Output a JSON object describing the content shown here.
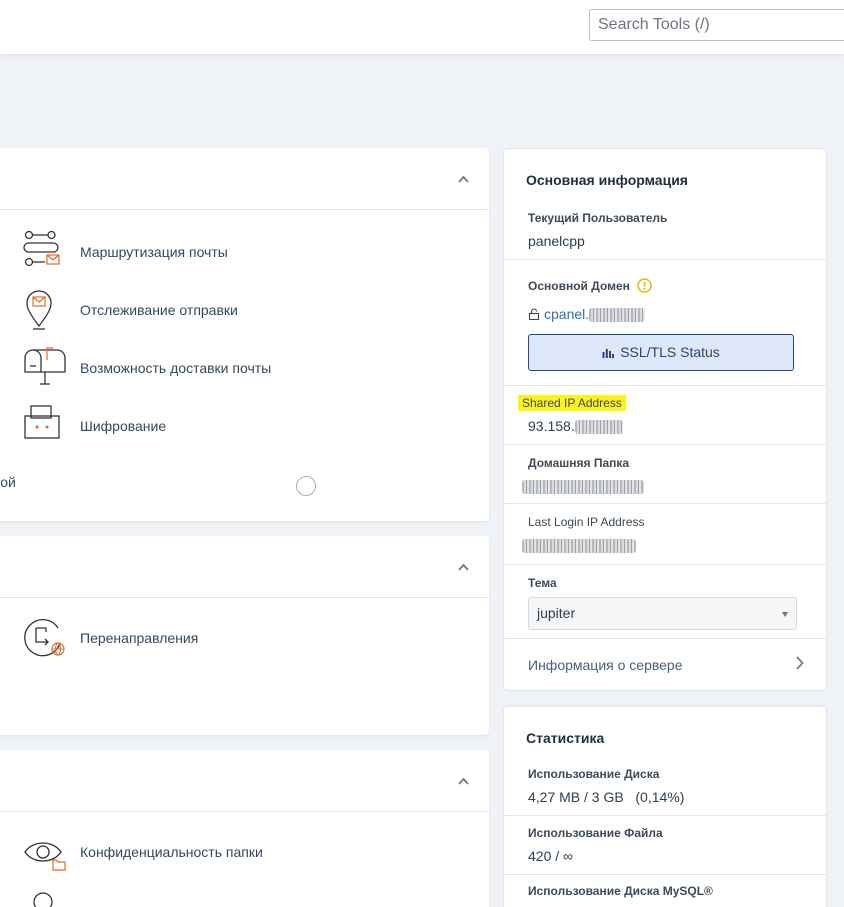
{
  "header": {
    "search_placeholder": "Search Tools (/)"
  },
  "email_section": {
    "tools": [
      {
        "label": "Маршрутизация почты",
        "icon": "mail-routing-icon"
      },
      {
        "label": "Отслеживание отправки",
        "icon": "track-delivery-icon"
      },
      {
        "label": "Возможность доставки почты",
        "icon": "mailbox-icon"
      },
      {
        "label": "Шифрование",
        "icon": "encryption-icon"
      }
    ],
    "partial_label": "той"
  },
  "forwarders_section": {
    "tools": [
      {
        "label": "Перенаправления",
        "icon": "forwarders-icon"
      }
    ]
  },
  "files_section": {
    "tools": [
      {
        "label": "Конфиденциальность папки",
        "icon": "directory-privacy-icon"
      }
    ]
  },
  "general_info": {
    "title": "Основная информация",
    "current_user_label": "Текущий Пользователь",
    "current_user_value": "panelcpp",
    "primary_domain_label": "Основной Домен",
    "primary_domain_value": "cpanel.",
    "ssl_button_label": "SSL/TLS Status",
    "shared_ip_label": "Shared IP Address",
    "shared_ip_value": "93.158.",
    "home_dir_label": "Домашняя Папка",
    "last_login_label": "Last Login IP Address",
    "theme_label": "Тема",
    "theme_value": "jupiter",
    "server_info_link": "Информация о сервере"
  },
  "statistics": {
    "title": "Статистика",
    "disk_usage_label": "Использование Диска",
    "disk_usage_value": "4,27 MB / 3 GB",
    "disk_usage_pct": "(0,14%)",
    "file_usage_label": "Использование Файла",
    "file_usage_value": "420 / ∞",
    "mysql_usage_label": "Использование Диска MySQL®"
  },
  "colors": {
    "accent": "#e4682a",
    "link": "#48617f",
    "highlight": "#fbf31a",
    "ssl_button_bg": "#dfe8fb"
  }
}
